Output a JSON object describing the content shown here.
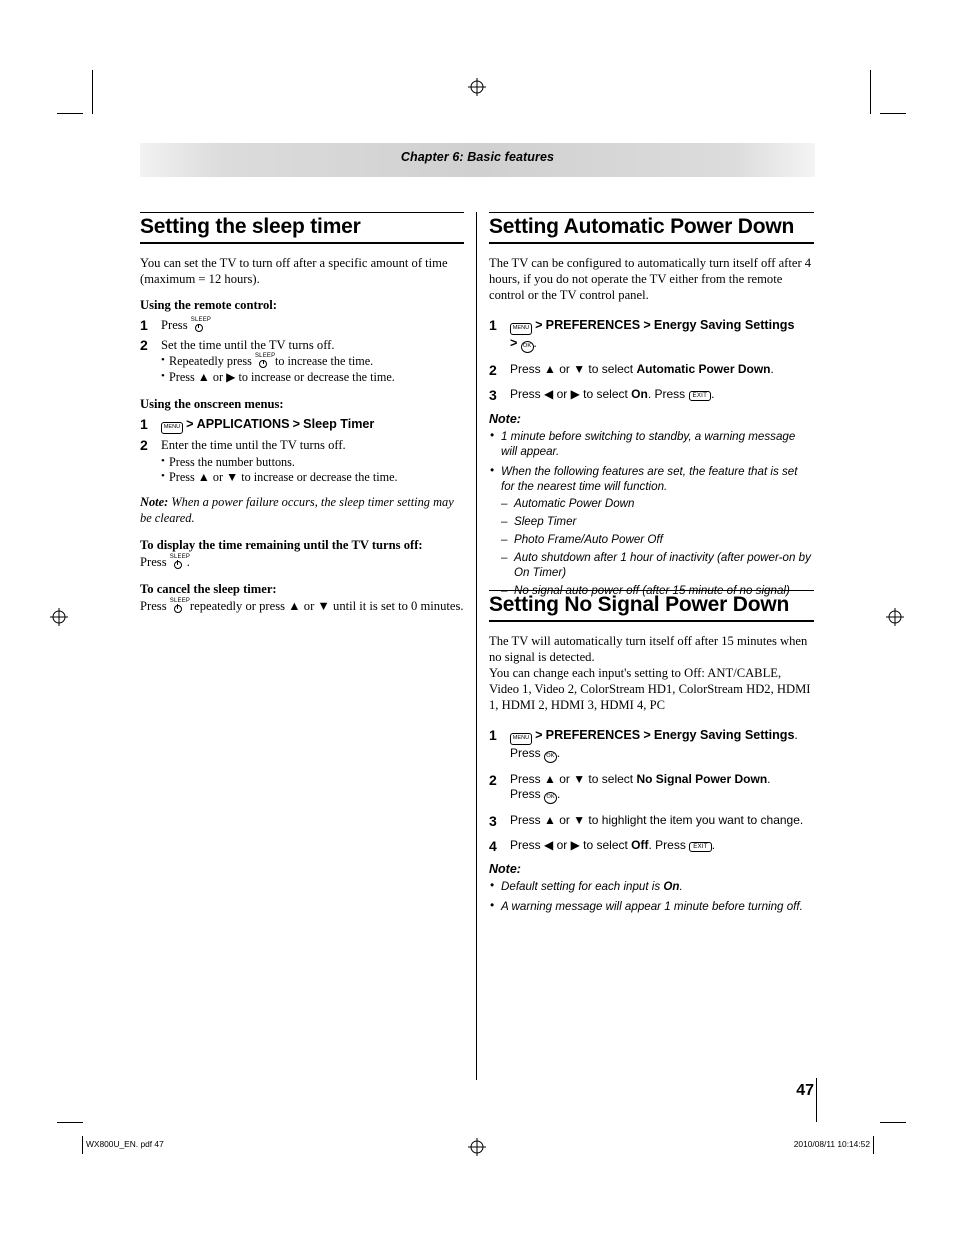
{
  "header": {
    "chapter": "Chapter 6: Basic features"
  },
  "page": {
    "number": "47"
  },
  "footer": {
    "left": "WX800U_EN. pdf    47",
    "right": "2010/08/11   10:14:52"
  },
  "left_column": {
    "heading": "Setting the sleep timer",
    "intro": "You can set the TV to turn off after a specific amount of time (maximum = 12 hours).",
    "sub1": "Using the remote control:",
    "step1_pre": "Press",
    "step2_text": "Set the time until the TV turns off.",
    "step2_bullets": [
      {
        "pre": "Repeatedly press",
        "post": "to increase the time."
      },
      {
        "text": "Press ▲ or ▶ to increase or decrease the time."
      }
    ],
    "sub2": "Using the onscreen menus:",
    "menu_key": "MENU",
    "menu_step_a": "APPLICATIONS",
    "menu_step_b": "Sleep Timer",
    "step2b_text": "Enter the time until the TV turns off.",
    "step2b_bullets": [
      "Press the number buttons.",
      "Press ▲ or ▼ to increase or decrease the time."
    ],
    "note_label": "Note:",
    "note_text": "When a power failure occurs, the sleep timer setting may be cleared.",
    "sub3": "To display the time remaining until the TV turns off:",
    "sub3_press": "Press",
    "sub4": "To cancel the sleep timer:",
    "sub4_pre": "Press",
    "sub4_post": "repeatedly or press ▲ or ▼ until it is set to 0 minutes."
  },
  "right_column_top": {
    "heading": "Setting Automatic Power Down",
    "intro": "The TV can be configured to automatically turn itself off after 4 hours, if you do not operate the TV either from the remote control or the TV control panel.",
    "step1_menu": "MENU",
    "step1_a": "PREFERENCES",
    "step1_b": "Energy Saving Settings",
    "step1_ok": "OK",
    "step2_pre": "Press ▲ or ▼ to select",
    "step2_bold": "Automatic Power Down",
    "step3_pre": "Press ◀ or ▶ to select",
    "step3_bold": "On",
    "step3_mid": ". Press",
    "step3_exit": "EXIT",
    "note_head": "Note:",
    "notes": [
      "1 minute before switching to standby, a warning message will appear.",
      "When the following features are set, the feature that is set for the nearest time will function."
    ],
    "feature_list": [
      "Automatic Power Down",
      "Sleep Timer",
      "Photo Frame/Auto Power Off",
      "Auto shutdown after 1 hour of inactivity (after power-on by On Timer)",
      "No signal auto power off (after 15 minute of no signal)"
    ]
  },
  "right_column_bottom": {
    "heading": "Setting No Signal Power Down",
    "intro1": "The TV will automatically turn itself off after 15 minutes when no signal is detected.",
    "intro2": "You can change each input's setting to Off: ANT/CABLE, Video 1, Video 2, ColorStream HD1, ColorStream HD2, HDMI 1, HDMI 2, HDMI 3, HDMI 4, PC",
    "step1_menu": "MENU",
    "step1_a": "PREFERENCES",
    "step1_b": "Energy Saving Settings",
    "step1_press": "Press",
    "step1_ok": "OK",
    "step2_pre": "Press ▲ or ▼ to select",
    "step2_bold": "No Signal Power Down",
    "step2_press": "Press",
    "step2_ok": "OK",
    "step3_text": "Press ▲ or ▼ to highlight the item you want to change.",
    "step4_pre": "Press ◀ or ▶ to select",
    "step4_bold": "Off",
    "step4_mid": ". Press",
    "step4_exit": "EXIT",
    "note_head": "Note:",
    "notes": [
      {
        "pre": "Default setting for each input is ",
        "bold": "On",
        "post": "."
      },
      {
        "pre": "A warning message will appear 1 minute before turning off.",
        "bold": "",
        "post": ""
      }
    ]
  }
}
